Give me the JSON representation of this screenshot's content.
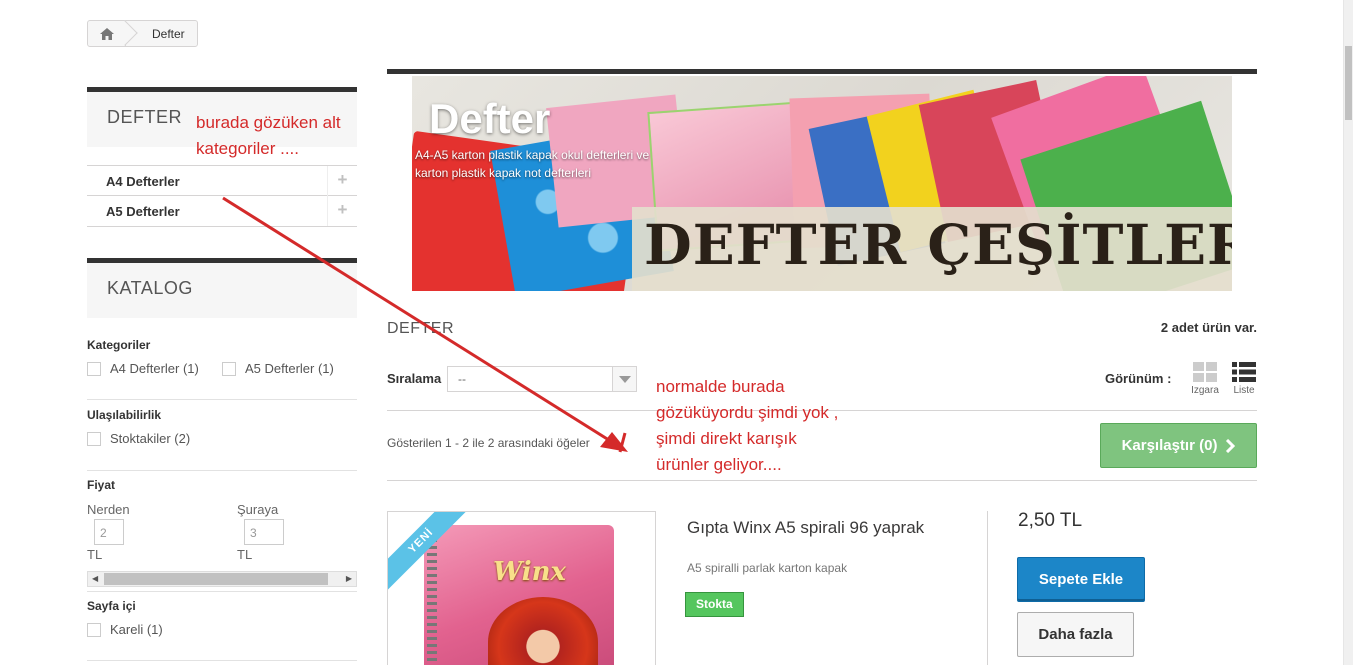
{
  "breadcrumb": {
    "home_icon": "home-icon",
    "current": "Defter"
  },
  "sidebar": {
    "category_block": {
      "title": "DEFTER",
      "items": [
        {
          "label": "A4 Defterler"
        },
        {
          "label": "A5 Defterler"
        }
      ]
    },
    "catalog_block": {
      "title": "KATALOG",
      "categories_label": "Kategoriler",
      "categories": [
        {
          "label": "A4 Defterler (1)"
        },
        {
          "label": "A5 Defterler (1)"
        }
      ],
      "availability_label": "Ulaşılabilirlik",
      "availability": [
        {
          "label": "Stoktakiler (2)"
        }
      ],
      "price_label": "Fiyat",
      "price_from_label": "Nerden",
      "price_to_label": "Şuraya",
      "price_from_value": "2",
      "price_to_value": "3",
      "currency": "TL",
      "pages_label": "Sayfa içi",
      "pages": [
        {
          "label": "Kareli (1)"
        }
      ]
    }
  },
  "banner": {
    "title": "Defter",
    "description": "A4-A5 karton plastik kapak okul defterleri ve karton plastik kapak not defterleri",
    "image_text": "DEFTER ÇEŞİTLERİ"
  },
  "listing": {
    "heading": "DEFTER",
    "count": "2 adet ürün var.",
    "sort_label": "Sıralama",
    "sort_value": "--",
    "view_label": "Görünüm :",
    "view_grid": "Izgara",
    "view_list": "Liste",
    "showing": "Gösterilen 1 - 2 ile 2 arasındaki öğeler",
    "compare_label": "Karşılaştır (0)"
  },
  "product": {
    "ribbon": "YENİ",
    "name": "Gıpta Winx A5 spirali 96 yaprak",
    "description": "A5 spiralli parlak karton kapak",
    "stock_badge": "Stokta",
    "price": "2,50 TL",
    "add_to_cart": "Sepete Ekle",
    "more": "Daha fazla",
    "image_logo": "Winx"
  },
  "annotations": {
    "note1_line1": "burada gözüken alt",
    "note1_line2": "kategoriler ....",
    "note2_line1": "normalde burada",
    "note2_line2": "gözüküyordu şimdi yok ,",
    "note2_line3": "şimdi direkt karışık",
    "note2_line4": "ürünler geliyor....",
    "color": "#d42a2a"
  },
  "colors": {
    "cart_button": "#1c86c8",
    "compare_button": "#7fc47f",
    "stock_badge": "#55c65e",
    "new_ribbon": "#5bc2e7"
  }
}
